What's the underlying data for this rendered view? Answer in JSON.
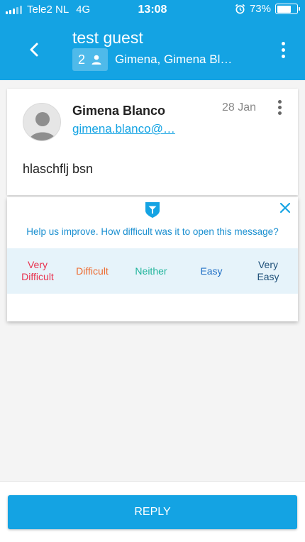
{
  "status_bar": {
    "carrier": "Tele2 NL",
    "network": "4G",
    "time": "13:08",
    "battery": "73%",
    "battery_level": 0.73
  },
  "header": {
    "title": "test guest",
    "participant_count": "2",
    "participants": "Gimena, Gimena Bl…"
  },
  "message": {
    "sender_name": "Gimena Blanco",
    "sender_email": "gimena.blanco@…",
    "date": "28 Jan",
    "body": "hlaschflj bsn"
  },
  "survey": {
    "question": "Help us improve. How difficult was it to open this message?",
    "options": [
      {
        "label_line1": "Very",
        "label_line2": "Difficult",
        "color": "#e8324f"
      },
      {
        "label_line1": "Difficult",
        "label_line2": "",
        "color": "#ee6a2e"
      },
      {
        "label_line1": "Neither",
        "label_line2": "",
        "color": "#1fb49b"
      },
      {
        "label_line1": "Easy",
        "label_line2": "",
        "color": "#1f6fc5"
      },
      {
        "label_line1": "Very",
        "label_line2": "Easy",
        "color": "#1d4f78"
      }
    ]
  },
  "footer": {
    "reply_label": "REPLY"
  },
  "colors": {
    "brand": "#14a3e3",
    "survey_background": "#e6f3fa"
  },
  "icons": {
    "back": "chevron-left-icon",
    "menu": "more-vertical-icon",
    "participants": "person-icon",
    "avatar": "user-avatar-icon",
    "survey_logo": "shield-logo-icon",
    "close": "close-icon",
    "alarm": "alarm-icon"
  }
}
